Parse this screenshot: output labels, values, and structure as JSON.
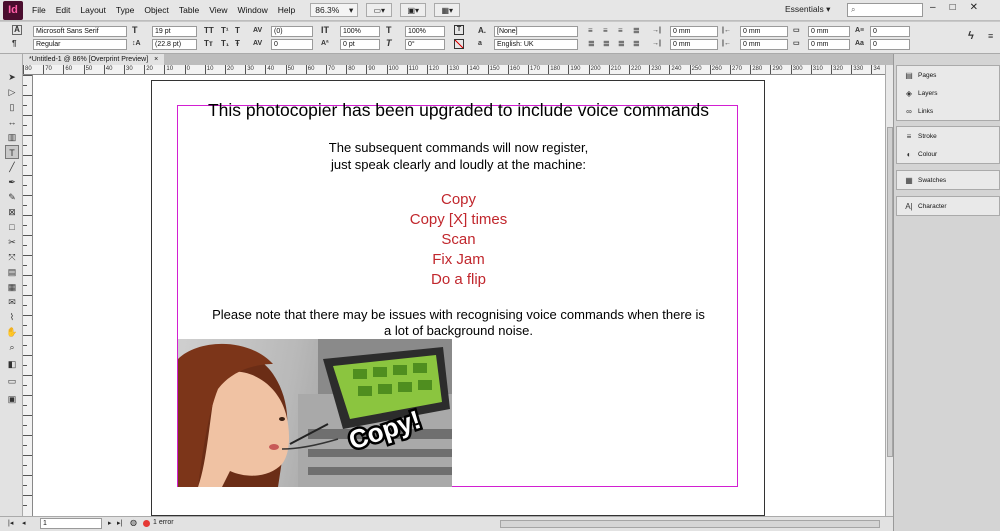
{
  "app": {
    "logo_text": "Id"
  },
  "menubar": {
    "items": [
      "File",
      "Edit",
      "Layout",
      "Type",
      "Object",
      "Table",
      "View",
      "Window",
      "Help"
    ],
    "zoom": "86.3%",
    "workspace": "Essentials ▾",
    "search_placeholder": "",
    "window_controls": [
      "–",
      "□",
      "✕"
    ]
  },
  "control_panel": {
    "font_family": "Microsoft Sans Serif",
    "font_style": "Regular",
    "font_size": "19 pt",
    "leading": "(22.8 pt)",
    "kerning": "(0)",
    "tracking": "0",
    "vscale": "100%",
    "hscale": "100%",
    "baseline": "0 pt",
    "skew": "0°",
    "char_style": "[None]",
    "language": "English: UK",
    "indent_left": "0 mm",
    "indent_right": "0 mm",
    "indent_first": "0 mm",
    "indent_last": "0 mm",
    "space_before": "0 mm",
    "space_after": "0 mm",
    "dropcap_lines": "0",
    "dropcap_chars": "0"
  },
  "document_tab": {
    "label": "*Untitled-1 @ 86% [Overprint Preview]",
    "close": "×"
  },
  "ruler": {
    "h_ticks": [
      "80",
      "70",
      "60",
      "50",
      "40",
      "30",
      "20",
      "10",
      "0",
      "10",
      "20",
      "30",
      "40",
      "50",
      "60",
      "70",
      "80",
      "90",
      "100",
      "110",
      "120",
      "130",
      "140",
      "150",
      "160",
      "170",
      "180",
      "190",
      "200",
      "210",
      "220",
      "230",
      "240",
      "250",
      "260",
      "270",
      "280",
      "290",
      "300",
      "310",
      "320",
      "330",
      "34"
    ]
  },
  "page": {
    "headline": "This photocopier has been upgraded to include voice commands",
    "intro_line1": "The subsequent commands will now register,",
    "intro_line2": "just speak clearly and loudly at the machine:",
    "commands": [
      "Copy",
      "Copy [X] times",
      "Scan",
      "Fix Jam",
      "Do a flip"
    ],
    "note_line1": "Please note that there may be issues with recognising voice commands when there is",
    "note_line2": "a lot of background noise.",
    "speech_bubble": "Copy!"
  },
  "statusbar": {
    "page": "1",
    "errors": "1 error"
  },
  "panels": {
    "group1": [
      {
        "icon": "pages-icon",
        "label": "Pages"
      },
      {
        "icon": "layers-icon",
        "label": "Layers"
      },
      {
        "icon": "links-icon",
        "label": "Links"
      }
    ],
    "group2": [
      {
        "icon": "stroke-icon",
        "label": "Stroke"
      },
      {
        "icon": "colour-icon",
        "label": "Colour"
      }
    ],
    "group3": [
      {
        "icon": "swatches-icon",
        "label": "Swatches"
      }
    ],
    "group4": [
      {
        "icon": "character-icon",
        "label": "Character"
      }
    ]
  },
  "colors": {
    "frame_edge": "#d21fd2",
    "command_red": "#c1272d",
    "app_gray": "#e6e6e6"
  }
}
